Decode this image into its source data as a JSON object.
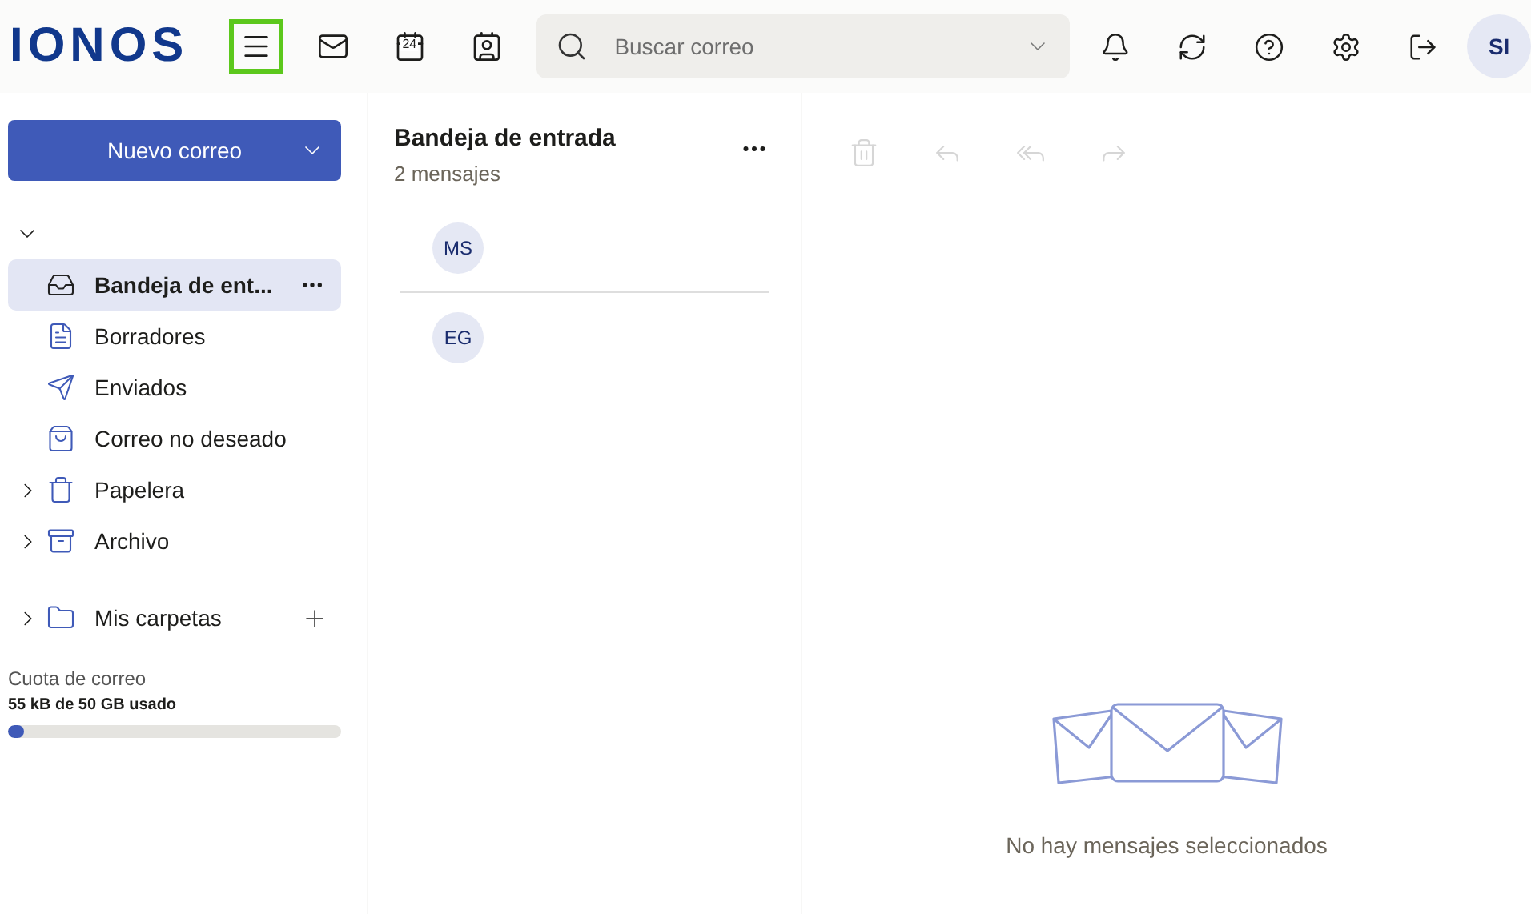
{
  "header": {
    "logo": "IONOS",
    "nav": [
      {
        "kind": "menu",
        "focused": true
      },
      {
        "kind": "mail",
        "focused": false
      },
      {
        "kind": "calendar",
        "label": "24",
        "focused": false
      },
      {
        "kind": "contacts",
        "focused": false
      }
    ],
    "search": {
      "placeholder": "Buscar correo"
    },
    "actions": [
      {
        "kind": "bell"
      },
      {
        "kind": "refresh"
      },
      {
        "kind": "help"
      },
      {
        "kind": "settings"
      },
      {
        "kind": "logout"
      }
    ],
    "avatar": "SI"
  },
  "sidebar": {
    "new_button": "Nuevo correo",
    "account_expanded": true,
    "folders": [
      {
        "kind": "inbox",
        "label": "Bandeja de ent...",
        "selected": true
      },
      {
        "kind": "drafts",
        "label": "Borradores",
        "selected": false
      },
      {
        "kind": "sent",
        "label": "Enviados",
        "selected": false
      },
      {
        "kind": "spam",
        "label": "Correo no deseado",
        "selected": false
      },
      {
        "kind": "trash",
        "label": "Papelera",
        "selected": false,
        "expanded": false
      },
      {
        "kind": "archive",
        "label": "Archivo",
        "selected": false,
        "expanded": false
      }
    ],
    "my_folders": {
      "label": "Mis carpetas",
      "expanded": false
    },
    "quota": {
      "title": "Cuota de correo",
      "usage": "55 kB de 50 GB usado",
      "level": 0.05
    }
  },
  "message_list": {
    "title": "Bandeja de entrada",
    "count": "2 mensajes",
    "messages": [
      {
        "initials": "MS"
      },
      {
        "initials": "EG"
      }
    ]
  },
  "reading_pane": {
    "toolbar": [
      {
        "kind": "delete",
        "disabled": true
      },
      {
        "kind": "reply",
        "disabled": true
      },
      {
        "kind": "reply-all",
        "disabled": true
      },
      {
        "kind": "forward",
        "disabled": true
      }
    ],
    "empty_text": "No hay mensajes seleccionados"
  }
}
